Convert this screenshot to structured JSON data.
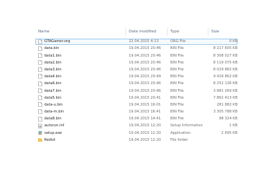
{
  "columns": {
    "name": "Name",
    "date": "Date modified",
    "type": "Type",
    "size": "Size"
  },
  "files": [
    {
      "name": "GTAGamer.org",
      "date": "22.04.2015 4:13",
      "type": "ORG File",
      "size": "0 KB",
      "icon": "file-icon",
      "selected": true
    },
    {
      "name": "data.bin",
      "date": "19.04.2015 20:46",
      "type": "BIN File",
      "size": "8 217 605 KB",
      "icon": "file-icon"
    },
    {
      "name": "data1.bin",
      "date": "19.04.2015 20:46",
      "type": "BIN File",
      "size": "8 308 027 KB",
      "icon": "file-icon"
    },
    {
      "name": "data2.bin",
      "date": "19.04.2015 20:46",
      "type": "BIN File",
      "size": "8 119 075 KB",
      "icon": "file-icon"
    },
    {
      "name": "data3.bin",
      "date": "19.04.2015 20:46",
      "type": "BIN File",
      "size": "8 029 882 KB",
      "icon": "file-icon"
    },
    {
      "name": "data4.bin",
      "date": "19.04.2015 20:49",
      "type": "BIN File",
      "size": "4 429 862 KB",
      "icon": "file-icon"
    },
    {
      "name": "data6.bin",
      "date": "19.04.2015 20:46",
      "type": "BIN File",
      "size": "8 252 136 KB",
      "icon": "file-icon"
    },
    {
      "name": "data7.bin",
      "date": "19.04.2015 20:46",
      "type": "BIN File",
      "size": "3 881 269 KB",
      "icon": "file-icon"
    },
    {
      "name": "data5.bin",
      "date": "19.04.2015 20:41",
      "type": "BIN File",
      "size": "7 862 413 KB",
      "icon": "file-icon"
    },
    {
      "name": "data-u.bin",
      "date": "19.04.2015 16:01",
      "type": "BIN File",
      "size": "281 882 KB",
      "icon": "file-icon"
    },
    {
      "name": "data-m.bin",
      "date": "19.04.2015 16:41",
      "type": "BIN File",
      "size": "3 305 788 KB",
      "icon": "file-icon"
    },
    {
      "name": "data8.bin",
      "date": "19.04.2015 14:41",
      "type": "BIN File",
      "size": "98 324 KB",
      "icon": "file-icon"
    },
    {
      "name": "autorun.inf",
      "date": "19.04.2015 12:20",
      "type": "Setup Information",
      "size": "1 KB",
      "icon": "setup-info-icon"
    },
    {
      "name": "setup.exe",
      "date": "19.04.2015 12:20",
      "type": "Application",
      "size": "2 695 KB",
      "icon": "application-icon"
    },
    {
      "name": "Redist",
      "date": "19.04.2015 12:20",
      "type": "File folder",
      "size": "",
      "icon": "folder-icon"
    }
  ]
}
